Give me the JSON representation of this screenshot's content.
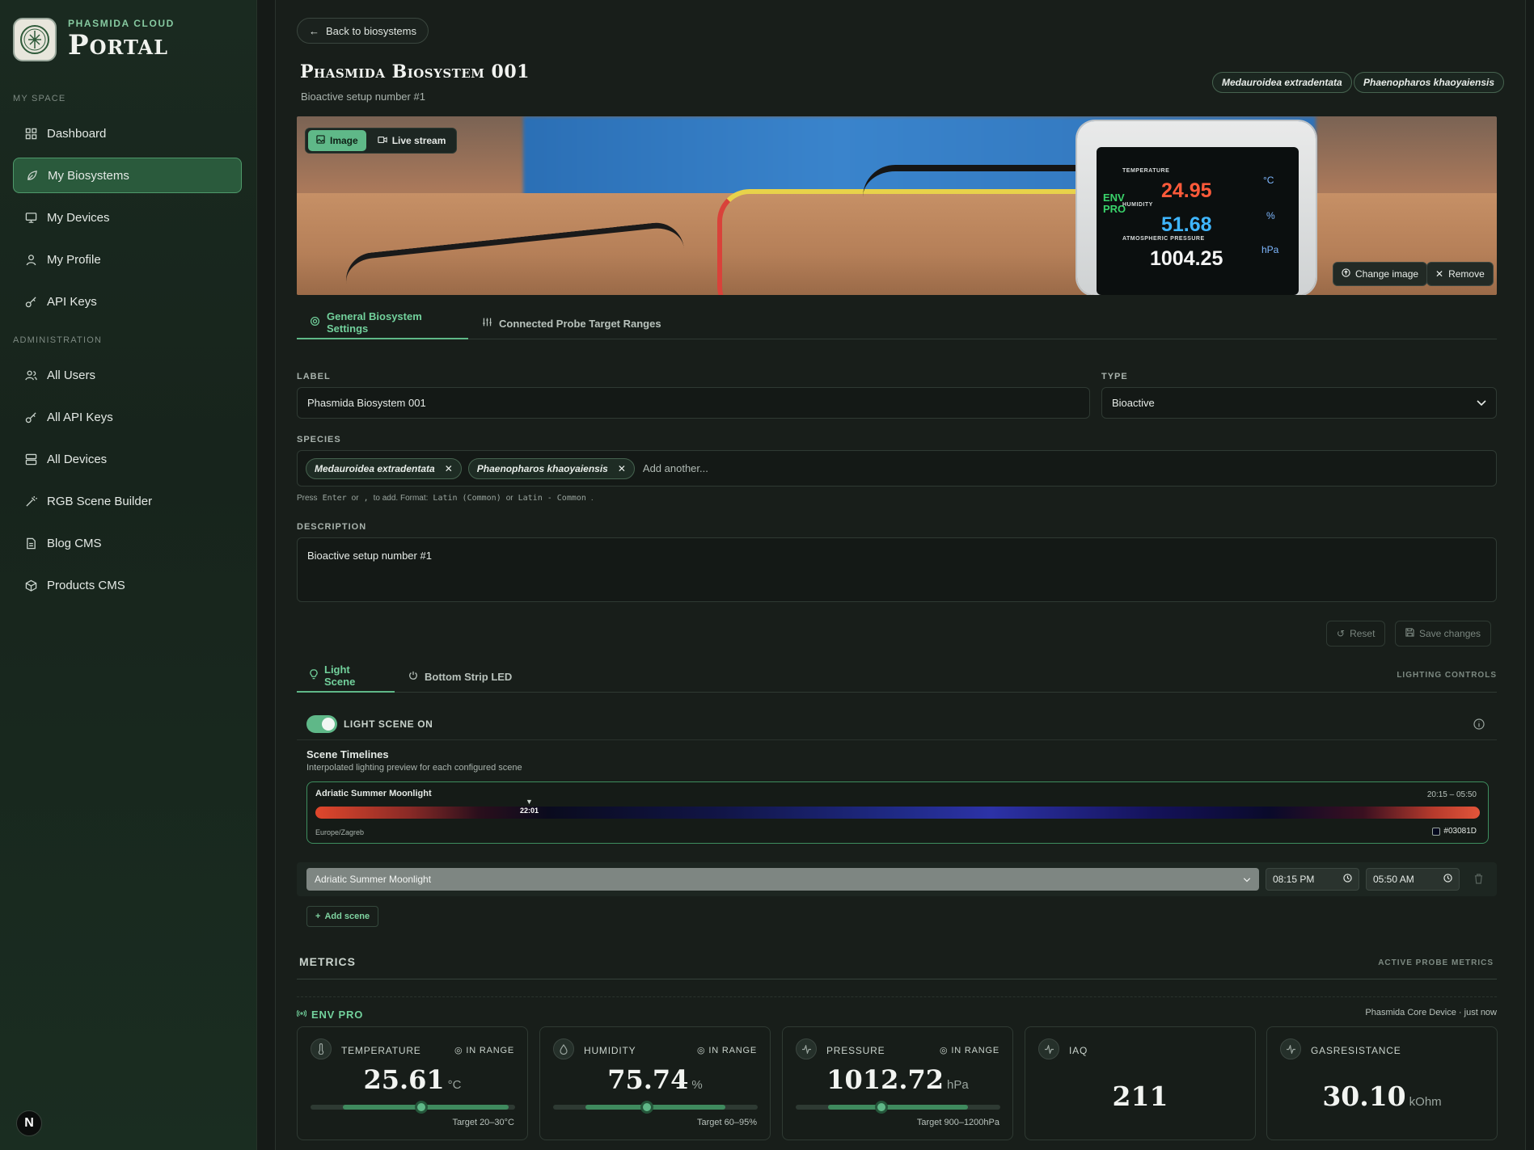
{
  "brand": {
    "subtitle": "PHASMIDA CLOUD",
    "title": "Portal"
  },
  "sidebar": {
    "section_my_space": "MY SPACE",
    "section_admin": "ADMINISTRATION",
    "items": [
      {
        "label": "Dashboard",
        "icon": "grid-icon"
      },
      {
        "label": "My Biosystems",
        "icon": "leaf-icon",
        "active": true
      },
      {
        "label": "My Devices",
        "icon": "monitor-icon"
      },
      {
        "label": "My Profile",
        "icon": "user-icon"
      },
      {
        "label": "API Keys",
        "icon": "key-icon"
      },
      {
        "label": "All Users",
        "icon": "users-icon"
      },
      {
        "label": "All API Keys",
        "icon": "key-icon"
      },
      {
        "label": "All Devices",
        "icon": "server-icon"
      },
      {
        "label": "RGB Scene Builder",
        "icon": "wand-icon"
      },
      {
        "label": "Blog CMS",
        "icon": "file-icon"
      },
      {
        "label": "Products CMS",
        "icon": "box-icon"
      }
    ],
    "framework_badge": "N"
  },
  "header": {
    "back_label": "Back to biosystems",
    "title": "Phasmida Biosystem 001",
    "subtitle": "Bioactive setup number #1",
    "species_chips": [
      "Medauroidea extradentata",
      "Phaenopharos khaoyaiensis"
    ]
  },
  "hero": {
    "mode_image": "Image",
    "mode_stream": "Live stream",
    "change_label": "Change image",
    "remove_label": "Remove",
    "screen": {
      "temp_label": "TEMPERATURE",
      "temp_value": "24.95",
      "temp_unit": "°C",
      "hum_label": "HUMIDITY",
      "hum_value": "51.68",
      "hum_unit": "%",
      "press_label": "ATMOSPHERIC PRESSURE",
      "press_value": "1004.25",
      "press_unit": "hPa",
      "vertical": "ENV PRO"
    }
  },
  "tabs": {
    "general": "General Biosystem Settings",
    "ranges": "Connected Probe Target Ranges"
  },
  "form": {
    "label_caption": "LABEL",
    "label_value": "Phasmida Biosystem 001",
    "type_caption": "TYPE",
    "type_value": "Bioactive",
    "species_caption": "SPECIES",
    "species_tags": [
      "Medauroidea extradentata",
      "Phaenopharos khaoyaiensis"
    ],
    "species_placeholder": "Add another...",
    "hint_press": "Press",
    "hint_enter": "Enter",
    "hint_or": "or",
    "hint_comma": ",",
    "hint_to_add": "to add. Format:",
    "hint_latin_common": "Latin (Common)",
    "hint_or2": "or",
    "hint_latin_dash": "Latin - Common",
    "hint_dot": ".",
    "description_caption": "DESCRIPTION",
    "description_value": "Bioactive setup number #1",
    "reset_label": "Reset",
    "save_label": "Save changes"
  },
  "lighting": {
    "tab_scene": "Light Scene",
    "tab_strip": "Bottom Strip LED",
    "caption": "LIGHTING CONTROLS",
    "toggle_label": "LIGHT SCENE ON",
    "timelines_title": "Scene Timelines",
    "timelines_sub": "Interpolated lighting preview for each configured scene",
    "timeline": {
      "name": "Adriatic Summer Moonlight",
      "range": "20:15 – 05:50",
      "marker": "22:01",
      "marker_fraction": 0.184,
      "timezone": "Europe/Zagreb",
      "color_hex": "#03081D"
    },
    "scene_select": "Adriatic Summer Moonlight",
    "start_time": "08:15 PM",
    "end_time": "05:50 AM",
    "add_scene": "Add scene"
  },
  "metrics": {
    "title": "METRICS",
    "caption": "ACTIVE PROBE METRICS",
    "probe_name": "ENV PRO",
    "probe_meta": "Phasmida Core Device · just now",
    "cards": [
      {
        "name": "TEMPERATURE",
        "state": "IN RANGE",
        "value": "25.61",
        "unit": "°C",
        "target": "Target 20–30°C",
        "icon": "thermometer-icon",
        "fill_start": 0.16,
        "fill_end": 0.97,
        "level": 0.54
      },
      {
        "name": "HUMIDITY",
        "state": "IN RANGE",
        "value": "75.74",
        "unit": "%",
        "target": "Target 60–95%",
        "icon": "droplet-icon",
        "fill_start": 0.16,
        "fill_end": 0.84,
        "level": 0.46
      },
      {
        "name": "PRESSURE",
        "state": "IN RANGE",
        "value": "1012.72",
        "unit": "hPa",
        "target": "Target 900–1200hPa",
        "icon": "activity-icon",
        "fill_start": 0.16,
        "fill_end": 0.84,
        "level": 0.42
      },
      {
        "name": "IAQ",
        "state": "",
        "value": "211",
        "unit": "",
        "target": "",
        "icon": "activity-icon"
      },
      {
        "name": "GASRESISTANCE",
        "state": "",
        "value": "30.10",
        "unit": "kOhm",
        "target": "",
        "icon": "activity-icon"
      }
    ]
  },
  "colors": {
    "accent": "#5fb888",
    "active_nav": "#2a5a3c",
    "background": "#151a17"
  }
}
